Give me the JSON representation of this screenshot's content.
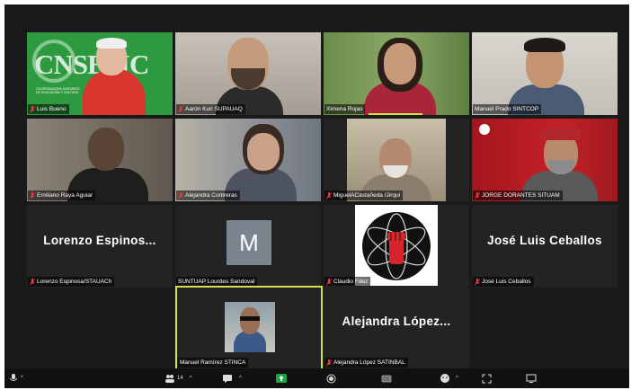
{
  "participants": [
    {
      "name": "Luis Bueno",
      "muted": true
    },
    {
      "name": "Aarón Kuri SUPAUAQ",
      "muted": true
    },
    {
      "name": "Ximena Rojas",
      "muted": false
    },
    {
      "name": "Manuel Prado SINTCOP",
      "muted": false
    },
    {
      "name": "Emiliano Raya Aguiar",
      "muted": true
    },
    {
      "name": "Alejandra Contreras",
      "muted": true
    },
    {
      "name": "MiguelACastañeda /Jirqui",
      "muted": true
    },
    {
      "name": "JORGE DORANTES SITUAM",
      "muted": true
    },
    {
      "name": "Lorenzo Espinosa/STAUACh",
      "muted": true,
      "display": "Lorenzo  Espinos..."
    },
    {
      "name": "SUNTUAP Lourdes Sandoval",
      "muted": false,
      "initial": "M"
    },
    {
      "name": "Claudio Fdez",
      "muted": true
    },
    {
      "name": "José Luis Ceballos",
      "muted": true,
      "display": "José Luis Ceballos"
    },
    {
      "name": "Manuel Ramírez STINCA",
      "muted": false,
      "active": true
    },
    {
      "name": "Alejandra López SATINBAL",
      "muted": true,
      "display": "Alejandra  López..."
    }
  ],
  "background_text": {
    "logo": "CNSESIC",
    "line1": "COORDINADORA",
    "line2": "DE EDUCACIÓN",
    "line3": "UNITARIOS",
    "line4": "Y CULTURA"
  },
  "toolbar": {
    "participants_count": "14"
  },
  "colors": {
    "mute_red": "#e8383d",
    "active_border": "#d6e04a",
    "share_green": "#1ea446"
  }
}
